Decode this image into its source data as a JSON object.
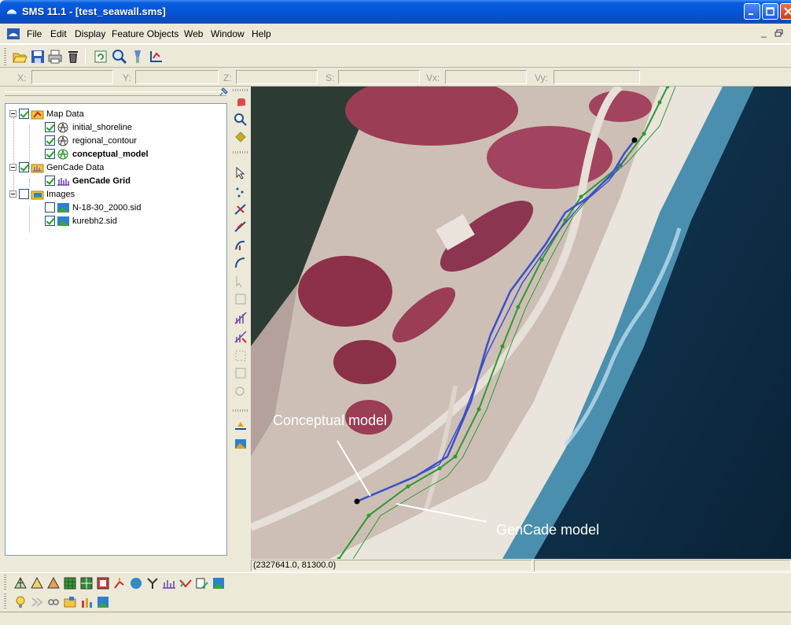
{
  "window": {
    "title": "SMS 11.1 - [test_seawall.sms]",
    "icon": "sms-app-icon"
  },
  "menu": {
    "items": [
      "File",
      "Edit",
      "Display",
      "Feature Objects",
      "Web",
      "Window",
      "Help"
    ],
    "mdi_min": "_",
    "mdi_restore": " "
  },
  "coords": {
    "x_label": "X:",
    "y_label": "Y:",
    "z_label": "Z:",
    "s_label": "S:",
    "vx_label": "Vx:",
    "vy_label": "Vy:"
  },
  "tree": {
    "map_data": "Map Data",
    "initial_shoreline": "initial_shoreline",
    "regional_contour": "regional_contour",
    "conceptual_model": "conceptual_model",
    "gencade_data": "GenCade Data",
    "gencade_grid": "GenCade Grid",
    "images": "Images",
    "image1": "N-18-30_2000.sid",
    "image2": "kurebh2.sid"
  },
  "status": {
    "coordinates": "(2327641.0, 81300.0)"
  },
  "annotations": {
    "conceptual": "Conceptual model",
    "gencade": "GenCade model"
  },
  "colors": {
    "conceptual_line": "#3c4fc9",
    "gencade_line": "#2f9a2f",
    "sea": "#0e2f4a"
  }
}
